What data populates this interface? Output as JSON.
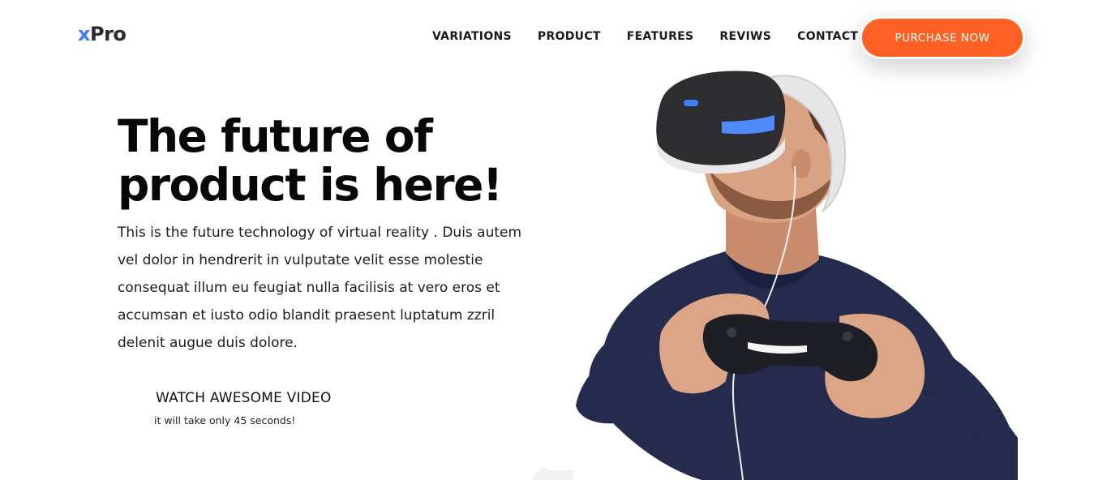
{
  "brand": {
    "logo_prefix": "x",
    "logo_suffix": "Pro"
  },
  "nav": {
    "items": [
      {
        "label": "VARIATIONS"
      },
      {
        "label": "PRODUCT"
      },
      {
        "label": "FEATURES"
      },
      {
        "label": "REVIWS"
      },
      {
        "label": "CONTACT"
      }
    ],
    "cta_label": "PURCHASE NOW"
  },
  "hero": {
    "title_line1": "The future of",
    "title_line2": "product is here!",
    "body": "This is the future technology of virtual reality . Duis autem vel dolor in hendrerit in vulputate velit esse molestie consequat illum eu feugiat nulla facilisis at vero eros et accumsan et iusto odio blandit praesent luptatum zzril delenit augue duis dolore.",
    "video_title": "WATCH AWESOME VIDEO",
    "video_subtitle": "it will take only 45 seconds!",
    "image_name": "man-with-vr-headset-and-controller"
  },
  "colors": {
    "accent": "#ff6124",
    "logo_x": "#3d7df5",
    "text": "#080808"
  }
}
